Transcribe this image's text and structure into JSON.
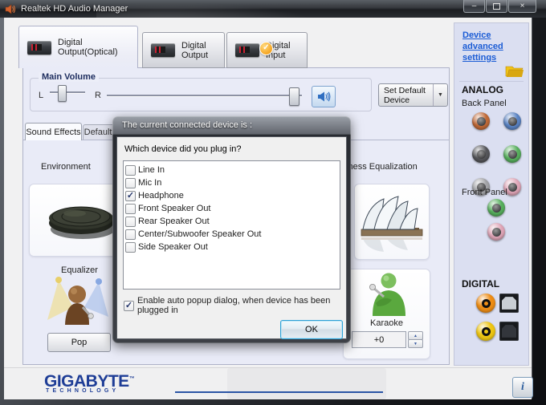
{
  "titlebar": {
    "title": "Realtek HD Audio Manager"
  },
  "icons": {
    "check": "✓",
    "dropdown": "▼",
    "up": "▲",
    "down": "▼",
    "minimize": "–",
    "close": "×",
    "info": "i"
  },
  "tabs": [
    {
      "label": "Digital Output(Optical)",
      "active": true
    },
    {
      "label": "Digital Output",
      "active": false
    },
    {
      "label": "Digital Input",
      "active": false,
      "badge_check": "✓"
    }
  ],
  "main": {
    "volume": {
      "group": "Main Volume",
      "l": "L",
      "r": "R",
      "balance_percent": 35,
      "volume_percent": 96
    },
    "set_default": {
      "line1": "Set Default",
      "line2": "Device"
    },
    "subtabs": [
      {
        "label": "Sound Effects"
      },
      {
        "label": "Default Format"
      }
    ],
    "environment": "Environment",
    "loudness": "Loudness Equalization",
    "equalizer": "Equalizer",
    "pop": "Pop",
    "karaoke": {
      "label": "Karaoke",
      "value": "+0"
    }
  },
  "dialog": {
    "title": "The current connected device is :",
    "question": "Which device did you plug in?",
    "devices": [
      {
        "label": "Line In",
        "checked": false
      },
      {
        "label": "Mic In",
        "checked": false
      },
      {
        "label": "Headphone",
        "checked": true
      },
      {
        "label": "Front Speaker Out",
        "checked": false
      },
      {
        "label": "Rear Speaker Out",
        "checked": false
      },
      {
        "label": "Center/Subwoofer Speaker Out",
        "checked": false
      },
      {
        "label": "Side Speaker Out",
        "checked": false
      }
    ],
    "auto_popup": {
      "label": "Enable auto popup dialog, when device has been plugged in",
      "checked": true
    },
    "ok_button": "OK"
  },
  "right_panel": {
    "link": "Device advanced settings",
    "analog": "ANALOG",
    "back_panel": "Back Panel",
    "front_panel": "Front Panel",
    "digital": "DIGITAL",
    "back_jacks": [
      {
        "name": "back-jack-orange",
        "ring": "#c06a38"
      },
      {
        "name": "back-jack-blue",
        "ring": "#5b84c4"
      },
      {
        "name": "back-jack-black",
        "ring": "#55565a"
      },
      {
        "name": "back-jack-green",
        "ring": "#58b05e"
      },
      {
        "name": "back-jack-gray",
        "ring": "#a3a4a8"
      },
      {
        "name": "back-jack-pink",
        "ring": "#e0a6b8"
      }
    ],
    "front_jacks": [
      {
        "name": "front-jack-green",
        "ring": "#58b05e"
      },
      {
        "name": "front-jack-pink",
        "ring": "#e0a6b8"
      }
    ],
    "digital_ports": [
      {
        "name": "spdif-orange",
        "rca": "#ee8d15",
        "optical": "#c9ced4"
      },
      {
        "name": "spdif-yellow",
        "rca": "#eec613",
        "optical": "#33363c"
      }
    ]
  },
  "footer": {
    "brand": "GIGABYTE",
    "tm": "™",
    "sub": "TECHNOLOGY"
  }
}
